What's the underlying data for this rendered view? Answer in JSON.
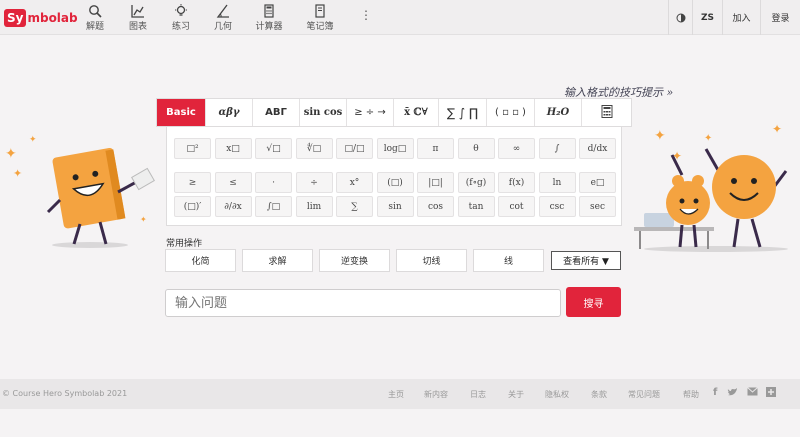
{
  "brand": {
    "logo_a": "Sy",
    "logo_b": "mbolab"
  },
  "nav": [
    {
      "id": "solve",
      "label": "解题",
      "icon": "search-icon"
    },
    {
      "id": "graph",
      "label": "图表",
      "icon": "graph-icon"
    },
    {
      "id": "practice",
      "label": "练习",
      "icon": "bulb-icon"
    },
    {
      "id": "geometry",
      "label": "几何",
      "icon": "angle-icon"
    },
    {
      "id": "calculator",
      "label": "计算器",
      "icon": "calculator-icon"
    },
    {
      "id": "notebook",
      "label": "笔记簿",
      "icon": "notebook-icon"
    }
  ],
  "header_right": {
    "theme_icon": "contrast-icon",
    "lang": "ZS",
    "join": "加入",
    "login": "登录"
  },
  "hint": "输入格式的技巧提示 »",
  "tabs": [
    "Basic",
    "αβγ",
    "ABΓ",
    "sin cos",
    "≥ ÷ →",
    "x̄ ℂ∀",
    "∑ ∫ ∏",
    "( ▫ ▫ )",
    "H₂O",
    "▦"
  ],
  "keys": [
    [
      "□²",
      "x□",
      "√□",
      "∜□",
      "□/□",
      "log□",
      "π",
      "θ",
      "∞",
      "∫",
      "d/dx"
    ],
    [
      "≥",
      "≤",
      "·",
      "÷",
      "x°",
      "(□)",
      "|□|",
      "(f∘g)",
      "f(x)",
      "ln",
      "e□"
    ],
    [
      "(□)′",
      "∂/∂x",
      "∫□",
      "lim",
      "∑",
      "sin",
      "cos",
      "tan",
      "cot",
      "csc",
      "sec"
    ]
  ],
  "ops": {
    "label": "常用操作",
    "buttons": [
      "化简",
      "求解",
      "逆变换",
      "切线",
      "线"
    ],
    "view_all": "查看所有 ▼"
  },
  "search": {
    "placeholder": "输入问题",
    "go": "搜寻"
  },
  "footer": {
    "copyright": "© Course Hero Symbolab 2021",
    "links": [
      "主页",
      "新内容",
      "日志",
      "关于",
      "隐私权",
      "条款",
      "常见问题",
      "帮助"
    ],
    "social": [
      "facebook-icon",
      "twitter-icon",
      "mail-icon",
      "plus-icon"
    ]
  },
  "colors": {
    "accent": "#e1243b",
    "mascot": "#f4a340"
  }
}
